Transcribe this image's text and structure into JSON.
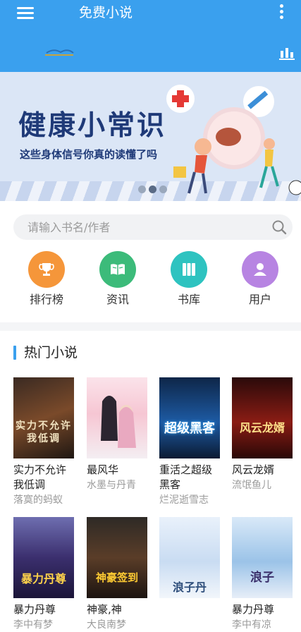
{
  "header": {
    "title": "免费小说",
    "menu_icon": "hamburger-menu-icon",
    "more_icon": "vertical-dots-icon",
    "rank_icon": "bar-chart-icon"
  },
  "banner": {
    "title": "健康小常识",
    "subtitle": "这些身体信号你真的读懂了吗",
    "slide_count": 3,
    "active_slide": 2
  },
  "search": {
    "placeholder": "请输入书名/作者"
  },
  "nav": [
    {
      "label": "排行榜",
      "icon": "trophy-icon",
      "color": "#f5963a"
    },
    {
      "label": "资讯",
      "icon": "book-open-icon",
      "color": "#3cbb7a"
    },
    {
      "label": "书库",
      "icon": "bookshelf-icon",
      "color": "#2ec3c0"
    },
    {
      "label": "用户",
      "icon": "user-icon",
      "color": "#b784e2"
    }
  ],
  "section": {
    "title": "热门小说"
  },
  "books": [
    {
      "name": "实力不允许我低调",
      "author": "落寞的蚂蚁",
      "cover_text": "实力不允许我低调"
    },
    {
      "name": "最风华",
      "author": "水墨与丹青",
      "cover_text": ""
    },
    {
      "name": "重活之超级黑客",
      "author": "烂泥逝雪志",
      "cover_text": "超级黑客"
    },
    {
      "name": "风云龙婿",
      "author": "流氓鱼儿",
      "cover_text": "风云龙婿"
    },
    {
      "name": "暴力丹尊",
      "author": "李中有梦",
      "cover_text": "暴力丹尊"
    },
    {
      "name": "神豪,神",
      "author": "大良南梦",
      "cover_text": "神豪签到"
    },
    {
      "name": "",
      "author": "",
      "cover_text": "浪子丹"
    },
    {
      "name": "暴力丹尊",
      "author": "李中有凉",
      "cover_text": "浪子"
    }
  ]
}
